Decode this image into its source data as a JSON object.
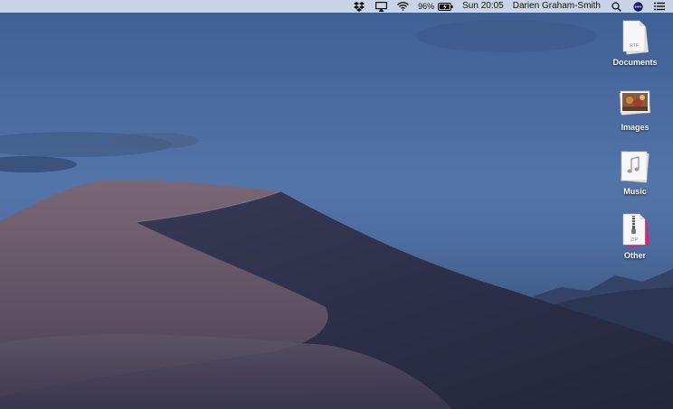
{
  "menubar": {
    "icons": [
      "dropbox-icon",
      "airplay-icon",
      "wifi-icon",
      "battery-icon",
      "spotlight-search-icon",
      "siri-icon",
      "notification-center-icon"
    ],
    "battery_percent": "96%",
    "battery_level": 0.96,
    "clock": "Sun 20:05",
    "user_name": "Darien Graham-Smith"
  },
  "desktop": {
    "wallpaper": "mojave-dunes-dusk",
    "stacks": [
      {
        "label": "Documents",
        "icon": "rtf-document-stack-icon",
        "badge": "RTF"
      },
      {
        "label": "Images",
        "icon": "photo-stack-icon"
      },
      {
        "label": "Music",
        "icon": "music-stack-icon"
      },
      {
        "label": "Other",
        "icon": "zip-archive-stack-icon",
        "badge": "ZIP"
      }
    ]
  },
  "colors": {
    "sky": "#4a6aa0",
    "dune_light": "#6f6172",
    "dune_dark": "#2f2d45",
    "menubar": "#d6deee"
  }
}
